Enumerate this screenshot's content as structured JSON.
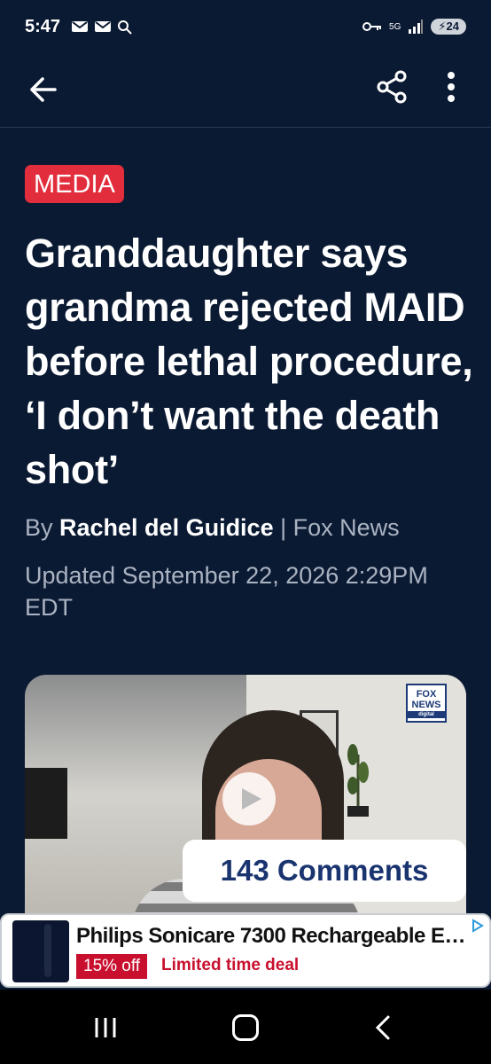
{
  "status_bar": {
    "time": "5:47",
    "network": "5G",
    "battery": "24"
  },
  "article": {
    "tag": "MEDIA",
    "headline": "Granddaughter says grandma rejected MAID before lethal procedure, ‘I don’t want the death shot’",
    "byline_prefix": "By ",
    "author": "Rachel del Guidice",
    "byline_separator": " | ",
    "source": "Fox News",
    "updated": "Updated September 22, 2026 2:29PM EDT"
  },
  "media": {
    "logo_line1": "FOX",
    "logo_line2": "NEWS",
    "logo_line3": "digital"
  },
  "comments_label": "143 Comments",
  "ad": {
    "title": "Philips Sonicare 7300 Rechargeable Ele...",
    "badge": "15% off",
    "deal": "Limited time deal"
  },
  "colors": {
    "background": "#0b1a33",
    "tag": "#e22d3c",
    "comments_text": "#1a3470",
    "ad_accent": "#c8102e"
  }
}
